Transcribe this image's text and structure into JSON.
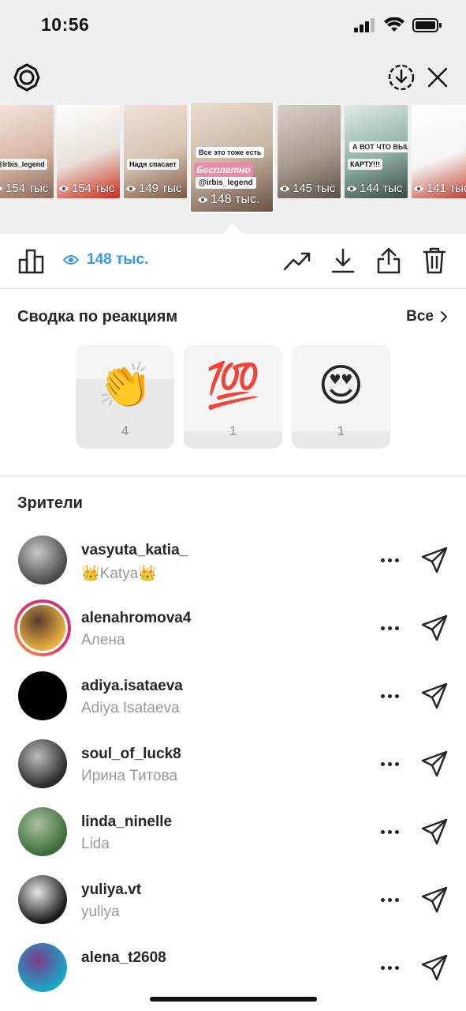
{
  "status_bar": {
    "time": "10:56"
  },
  "stories": [
    {
      "views": "154 тыс",
      "badge": "@irbis_legend",
      "colors": [
        "#d8b7a6",
        "#f3e6df",
        "#8a6a58"
      ]
    },
    {
      "views": "154 тыс",
      "colors": [
        "#e8e0d8",
        "#ffffff",
        "#cc2a1a"
      ]
    },
    {
      "views": "149 тыс",
      "badge": "Надя спасает",
      "colors": [
        "#d6c2b2",
        "#efe3d7",
        "#7b5b48"
      ]
    },
    {
      "views": "148 тыс.",
      "active": true,
      "badge": "Бесплатно",
      "handle": "@irbis_legend",
      "caption": "Все это тоже есть",
      "colors": [
        "#c9b6a3",
        "#efe6dc",
        "#6b5143"
      ]
    },
    {
      "views": "145 тыс",
      "colors": [
        "#a89c90",
        "#d8d0c8",
        "#5d5048"
      ]
    },
    {
      "views": "144 тыс",
      "badge": "КАРТУ!!!",
      "caption": "А ВОТ ЧТО ВЫШЛО!!!",
      "colors": [
        "#8fb1a5",
        "#dfeae6",
        "#3b4a45"
      ]
    },
    {
      "views": "141 тыс",
      "colors": [
        "#f4f4f4",
        "#ffffff",
        "#c0392b"
      ]
    }
  ],
  "action_bar": {
    "views_count": "148 тыс."
  },
  "reactions": {
    "title": "Сводка по реакциям",
    "all_label": "Все",
    "items": [
      {
        "emoji": "👏",
        "count": "4",
        "level": 0.67
      },
      {
        "emoji": "💯",
        "count": "1",
        "level": 0.17
      },
      {
        "emoji": "😍",
        "count": "1",
        "level": 0.17
      }
    ]
  },
  "viewers": {
    "title": "Зрители",
    "list": [
      {
        "username": "vasyuta_katia_",
        "fullname": "👑Katya👑",
        "avatar_colors": [
          "#4a4a4a",
          "#c9c9c9"
        ],
        "ring": false
      },
      {
        "username": "alenahromova4",
        "fullname": "Алена",
        "avatar_colors": [
          "#e8b041",
          "#5a3b2a"
        ],
        "ring": true
      },
      {
        "username": "adiya.isataeva",
        "fullname": "Adiya Isataeva",
        "avatar_colors": [
          "#000000",
          "#000000"
        ],
        "ring": false
      },
      {
        "username": "soul_of_luck8",
        "fullname": "Ирина Титова",
        "avatar_colors": [
          "#2a2a2a",
          "#bdbdbd"
        ],
        "ring": false
      },
      {
        "username": "linda_ninelle",
        "fullname": "Lida",
        "avatar_colors": [
          "#3e6b3a",
          "#a7c2a0"
        ],
        "ring": false
      },
      {
        "username": "yuliya.vt",
        "fullname": "yuliya",
        "avatar_colors": [
          "#1a1a1a",
          "#e6e6e6"
        ],
        "ring": false
      },
      {
        "username": "alena_t2608",
        "fullname": "",
        "avatar_colors": [
          "#19a8c7",
          "#7a3a8a"
        ],
        "ring": false
      }
    ]
  },
  "colors": {
    "accent_blue": "#3897f0",
    "text": "#262626",
    "secondary": "#999999"
  }
}
